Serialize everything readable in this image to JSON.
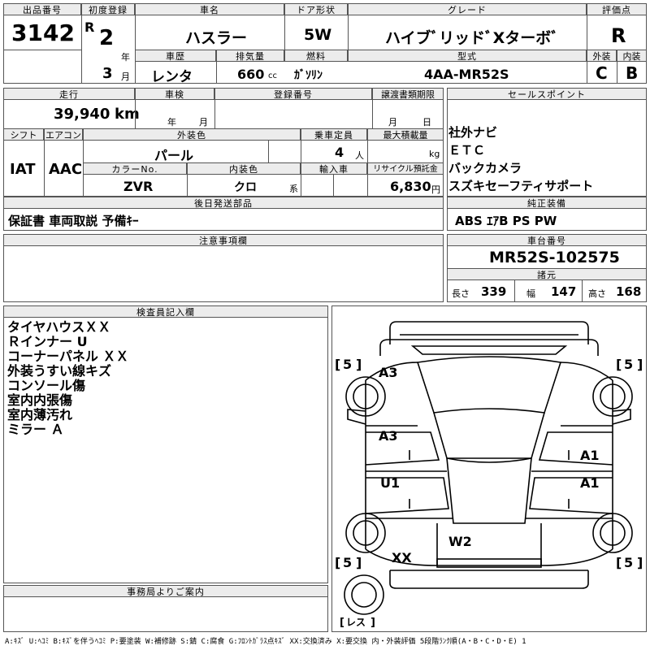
{
  "header": {
    "lot_label": "出品番号",
    "lot_number": "3142",
    "first_reg_label": "初度登録",
    "era_letter": "R",
    "era_year": "2",
    "year_unit": "年",
    "month": "3",
    "month_unit": "月",
    "model_label": "車名",
    "model": "ハスラー",
    "door_label": "ドア形状",
    "door": "5W",
    "grade_label": "グレード",
    "grade": "ハイブﾞリッドﾞXターボﾞ",
    "score_label": "評価点",
    "score": "R",
    "history_label": "車歴",
    "history": "レンタ",
    "displacement_label": "排気量",
    "displacement": "660",
    "displacement_unit": "cc",
    "fuel_label": "燃料",
    "fuel": "ｶﾞｿﾘﾝ",
    "type_label": "型式",
    "type": "4AA-MR52S",
    "exterior_label": "外装",
    "exterior": "C",
    "interior_label": "内装",
    "interior": "B"
  },
  "row2": {
    "mileage_label": "走行",
    "mileage": "39,940",
    "mileage_unit": "km",
    "inspection_label": "車検",
    "year_unit": "年",
    "month_unit": "月",
    "reg_no_label": "登録番号",
    "transfer_label": "譲渡書類期限",
    "t_month": "月",
    "t_day": "日",
    "sales_label": "セールスポイント",
    "sales_points": [
      "社外ナビ",
      "ＥＴＣ",
      "バックカメラ",
      "スズキセーフティサポート"
    ],
    "shift_label": "シフト",
    "shift": "IAT",
    "ac_label": "エアコン",
    "ac": "AAC",
    "ext_color_label": "外装色",
    "ext_color": "パール",
    "capacity_label": "乗車定員",
    "capacity": "4",
    "capacity_unit": "人",
    "max_load_label": "最大積載量",
    "max_load_unit": "kg",
    "color_no_label": "カラーNo.",
    "color_no": "ZVR",
    "int_color_label": "内装色",
    "int_color": "クロ",
    "int_color_unit": "系",
    "import_label": "輸入車",
    "recycle_label": "リサイクル預託金",
    "recycle": "6,830",
    "recycle_unit": "円"
  },
  "later_parts": {
    "label": "後日発送部品",
    "value": "保証書  車両取説  予備ｷｰ"
  },
  "genuine": {
    "label": "純正装備",
    "value": "ABS  ｴｱB  PS  PW"
  },
  "caution": {
    "label": "注意事項欄"
  },
  "chassis": {
    "label": "車台番号",
    "value": "MR52S-102575",
    "spec_label": "諸元",
    "length_label": "長さ",
    "length": "339",
    "width_label": "幅",
    "width": "147",
    "height_label": "高さ",
    "height": "168"
  },
  "inspector": {
    "label": "検査員記入欄",
    "notes": [
      "タイヤハウスＸＸ",
      "Ｒインナー U",
      "コーナーパネル ＸＸ",
      "外装うすい線キズ",
      "コンソール傷",
      "室内内張傷",
      "室内薄汚れ",
      "ミラー Ａ"
    ]
  },
  "office": {
    "label": "事務局よりご案内"
  },
  "diagram": {
    "tire_fl": "5",
    "tire_fr": "5",
    "tire_rl": "5",
    "tire_rr": "5",
    "spare": "レス",
    "marks": [
      "A3",
      "A3",
      "U1",
      "A1",
      "A1",
      "W2",
      "XX"
    ]
  },
  "legend": "A:ｷｽﾞ U:ﾍｺﾐ B:ｷｽﾞを伴うﾍｺﾐ P:要塗装 W:補修跡 S:錆 C:腐食 G:ﾌﾛﾝﾄｶﾞﾗｽ点ｷｽﾞ XX:交換済み X:要交換 内・外装評価 5段階ﾗﾝｸ順(A・B・C・D・E) 1"
}
